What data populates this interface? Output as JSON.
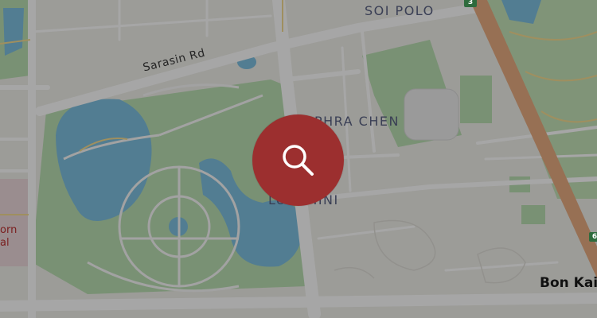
{
  "map": {
    "labels": {
      "soi_polo": "SOI POLO",
      "phra_chen": "PHRA CHEN",
      "lumphini": "LUMPHINI",
      "sarasin_rd": "Sarasin Rd",
      "bon_kai": "Bon Kai",
      "partial_left_line1": "orn",
      "partial_left_line2": "al"
    },
    "shields": {
      "top": "3",
      "right": "6"
    },
    "colors": {
      "park": "#a9d7a0",
      "water": "#5fb1d8",
      "road": "#ffffff",
      "major_road": "#f0a26a",
      "overlay": "rgba(70,70,70,0.48)",
      "search_button": "#9c2f2f"
    }
  },
  "search_button": {
    "icon": "search-icon"
  }
}
